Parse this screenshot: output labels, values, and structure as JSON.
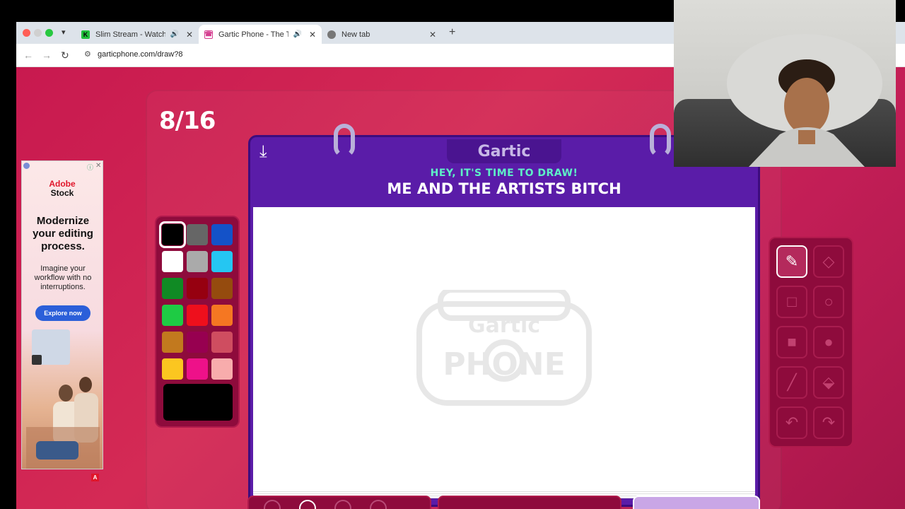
{
  "browser": {
    "tabs": [
      {
        "title": "Slim Stream - Watch Live",
        "favicon_color": "#1fbf3a",
        "audio": true
      },
      {
        "title": "Gartic Phone - The Telephone",
        "favicon_color": "#d43b8f",
        "audio": true,
        "active": true
      },
      {
        "title": "New tab",
        "favicon_color": "#666666",
        "audio": false
      }
    ],
    "url": "garticphone.com/draw?8"
  },
  "game": {
    "round": "8/16",
    "logo": "Gartic",
    "prompt_kicker": "HEY, IT'S TIME TO DRAW!",
    "prompt": "ME AND THE ARTISTS BITCH",
    "palette": [
      "#000000",
      "#666666",
      "#1452c8",
      "#ffffff",
      "#aaaaaa",
      "#25c6f2",
      "#108a24",
      "#960010",
      "#954b0e",
      "#1ecb44",
      "#ee0f1c",
      "#f57722",
      "#c2791e",
      "#970050",
      "#cf4d60",
      "#fbc620",
      "#ee1189",
      "#f8acac"
    ],
    "selected_color": "#000000",
    "tools": [
      "pencil",
      "eraser",
      "rect-outline",
      "circle-outline",
      "rect-fill",
      "circle-fill",
      "line",
      "bucket",
      "undo",
      "redo"
    ],
    "selected_tool": "pencil"
  },
  "ad": {
    "brand_line1": "Adobe",
    "brand_line2": "Stock",
    "headline": "Modernize your editing process.",
    "sub": "Imagine your workflow with no interruptions.",
    "button": "Explore now"
  }
}
